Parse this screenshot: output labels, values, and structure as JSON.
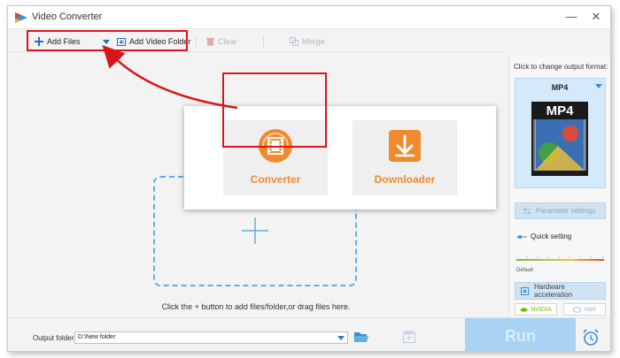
{
  "app": {
    "title": "Video Converter",
    "minimize": "—",
    "close": "✕"
  },
  "toolbar": {
    "add_files": "Add Files",
    "add_video_folder": "Add Video Folder",
    "clear": "Clear",
    "merge": "Merge"
  },
  "main": {
    "drop_hint": "Click the + button to add files/folder,or drag files here."
  },
  "popup": {
    "converter": "Converter",
    "downloader": "Downloader"
  },
  "right_panel": {
    "change_format_label": "Click to change output format:",
    "format": "MP4",
    "format_thumb_text": "MP4",
    "parameter_settings": "Parameter settings",
    "quick_setting": "Quick setting",
    "default_label": "Default",
    "hardware_acceleration": "Hardware acceleration",
    "nvidia": "NVIDIA",
    "intel": "Intel"
  },
  "bottom": {
    "output_folder_label": "Output folder:",
    "output_folder_value": "D:\\New folder",
    "run": "Run"
  },
  "colors": {
    "accent_orange": "#f08a2e",
    "highlight_red": "#d9151b",
    "blue": "#3a8fd6",
    "run_bg": "#a9d3f3"
  }
}
